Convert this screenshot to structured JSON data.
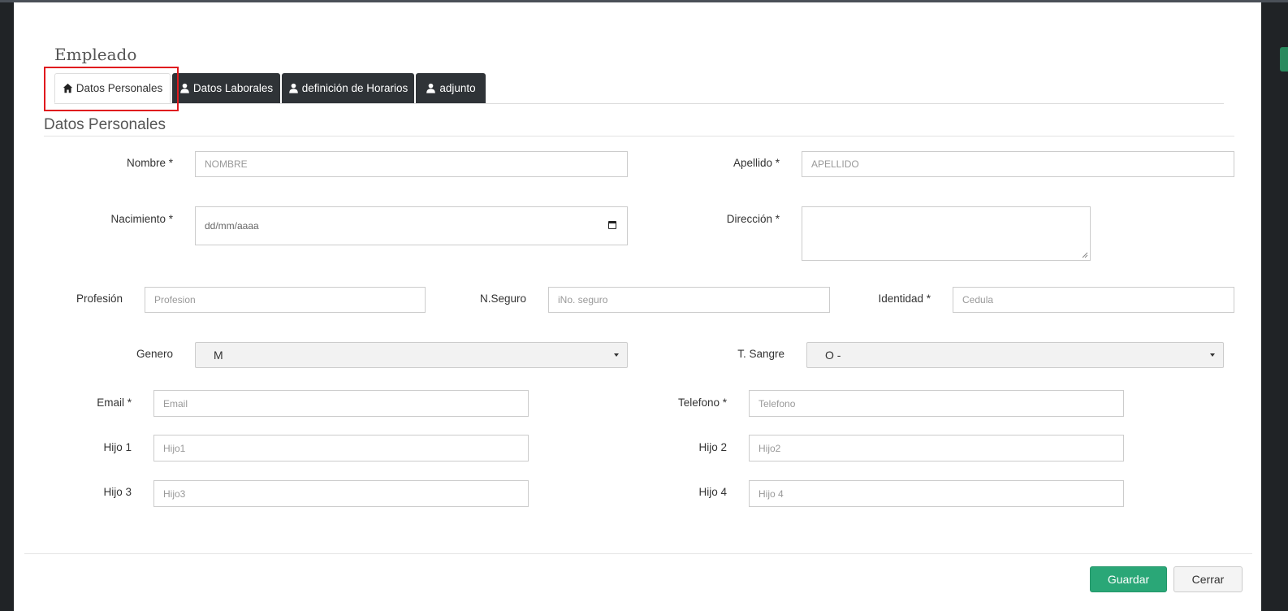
{
  "modal": {
    "title": "Empleado",
    "section_title": "Datos Personales"
  },
  "tabs": [
    {
      "label": "Datos Personales",
      "icon": "home-icon",
      "active": true
    },
    {
      "label": "Datos Laborales",
      "icon": "user-icon",
      "active": false
    },
    {
      "label": "definición de Horarios",
      "icon": "user-icon",
      "active": false
    },
    {
      "label": "adjunto",
      "icon": "user-icon",
      "active": false
    }
  ],
  "form": {
    "nombre": {
      "label": "Nombre *",
      "placeholder": "NOMBRE"
    },
    "apellido": {
      "label": "Apellido *",
      "placeholder": "APELLIDO"
    },
    "nacimiento": {
      "label": "Nacimiento *",
      "placeholder": "dd/mm/aaaa"
    },
    "direccion": {
      "label": "Dirección *"
    },
    "profesion": {
      "label": "Profesión",
      "placeholder": "Profesion"
    },
    "nseguro": {
      "label": "N.Seguro",
      "placeholder": "iNo. seguro"
    },
    "identidad": {
      "label": "Identidad *",
      "placeholder": "Cedula"
    },
    "genero": {
      "label": "Genero",
      "value": "M"
    },
    "tsangre": {
      "label": "T. Sangre",
      "value": "O -"
    },
    "email": {
      "label": "Email *",
      "placeholder": "Email"
    },
    "telefono": {
      "label": "Telefono *",
      "placeholder": "Telefono"
    },
    "hijo1": {
      "label": "Hijo 1",
      "placeholder": "Hijo1"
    },
    "hijo2": {
      "label": "Hijo 2",
      "placeholder": "Hijo2"
    },
    "hijo3": {
      "label": "Hijo 3",
      "placeholder": "Hijo3"
    },
    "hijo4": {
      "label": "Hijo 4",
      "placeholder": "Hijo 4"
    }
  },
  "footer": {
    "save_label": "Guardar",
    "close_label": "Cerrar"
  },
  "colors": {
    "tab_dark": "#2f3337",
    "save_green": "#2aa777",
    "highlight_red": "#e0191e"
  }
}
